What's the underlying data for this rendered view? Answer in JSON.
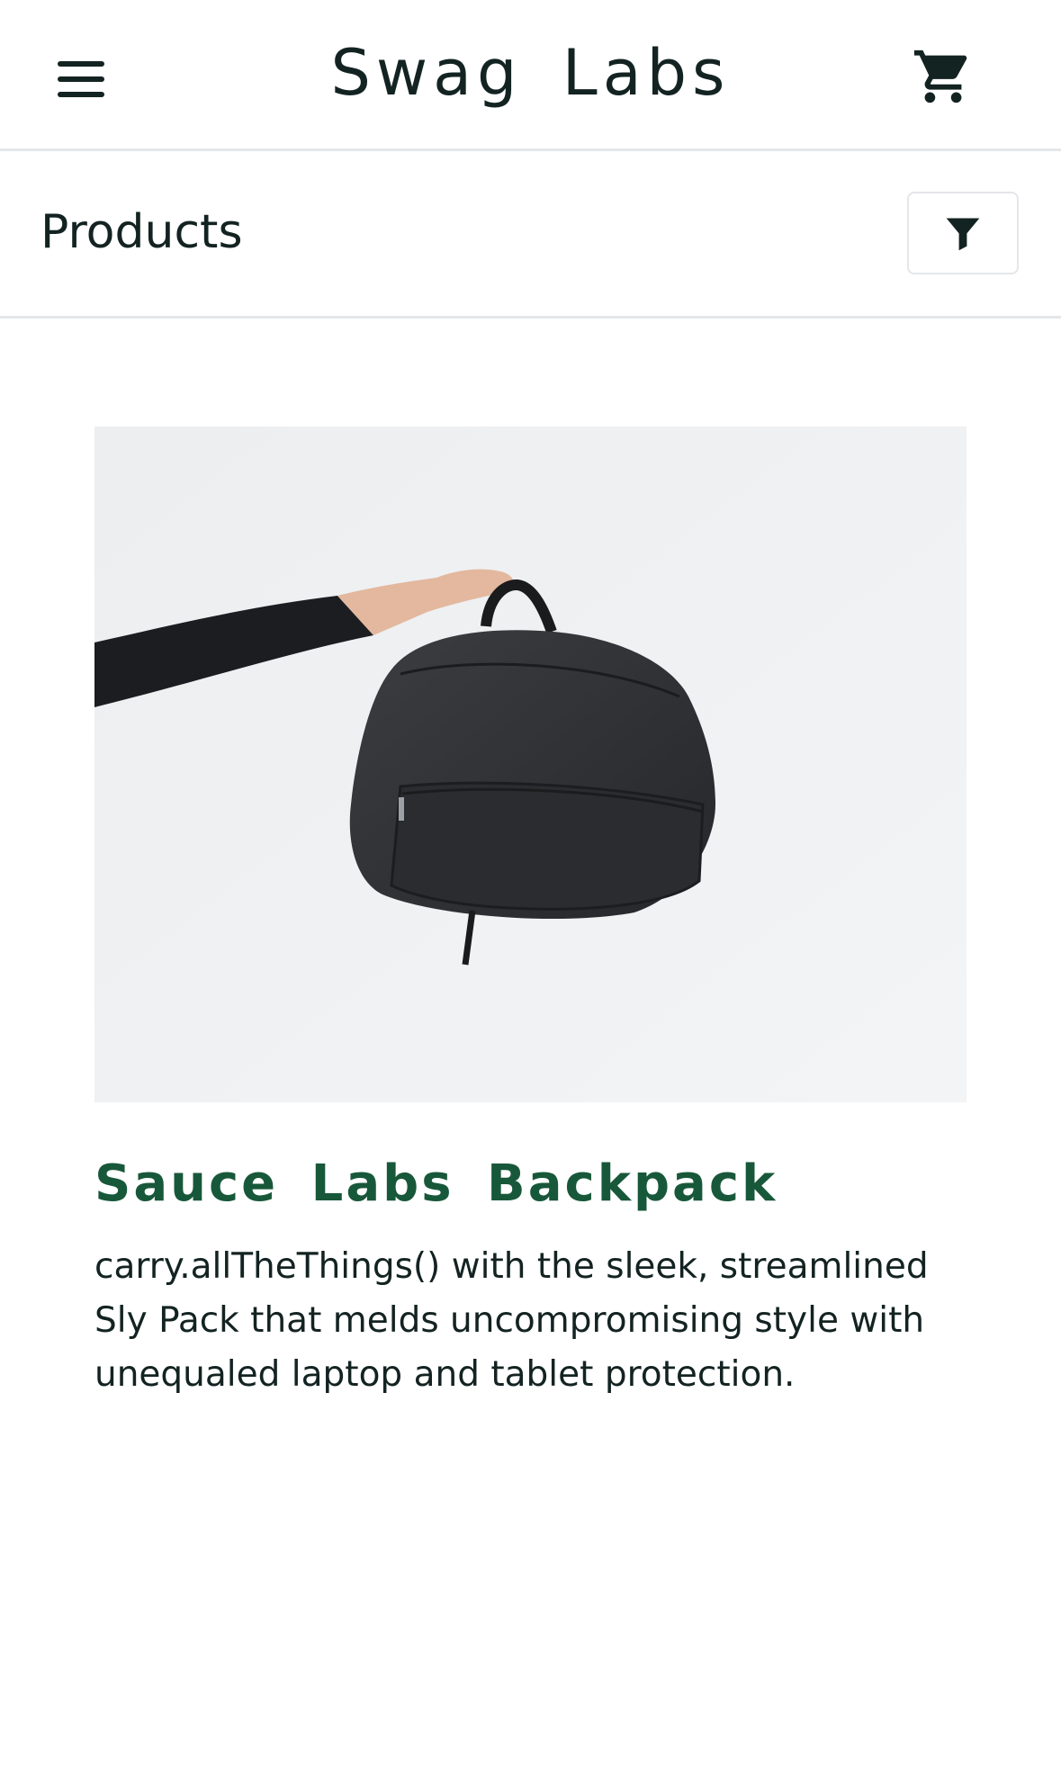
{
  "header": {
    "title": "Swag Labs",
    "menu_icon": "hamburger-menu-icon",
    "cart_icon": "shopping-cart-icon"
  },
  "subheader": {
    "title": "Products",
    "filter_icon": "filter-icon"
  },
  "product": {
    "name": "Sauce Labs Backpack",
    "description": "carry.allTheThings() with the sleek, streamlined Sly Pack that melds uncompromising style with unequaled laptop and tablet protection.",
    "image": "backpack-photo"
  },
  "colors": {
    "text": "#132322",
    "product_name": "#18583a",
    "divider": "#e4e6ea",
    "background": "#ffffff"
  }
}
